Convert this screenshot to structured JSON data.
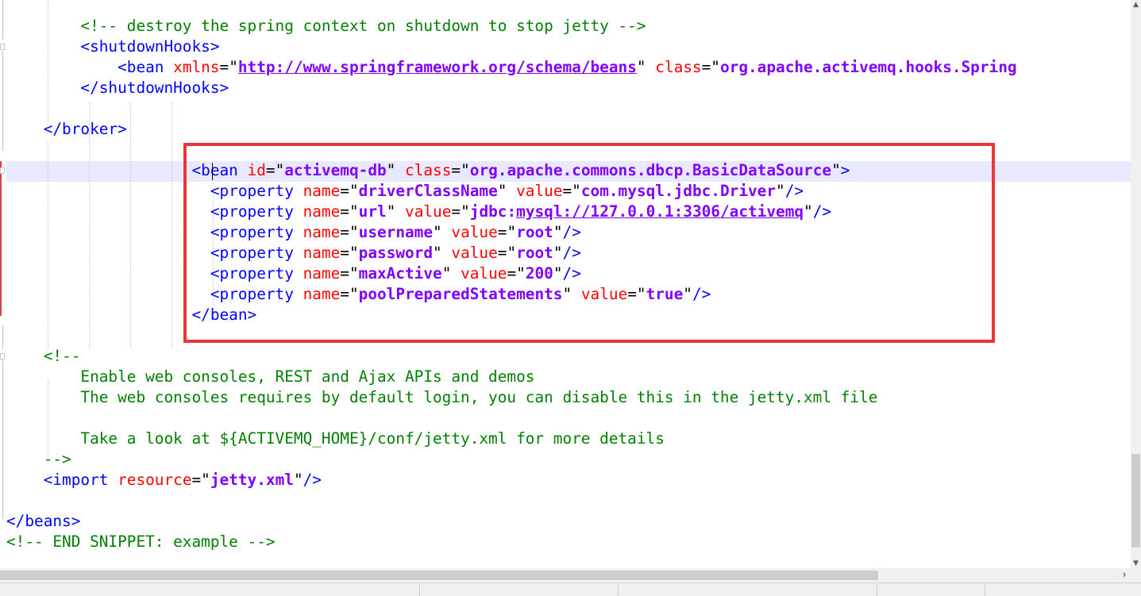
{
  "editor": {
    "lines": [
      [
        {
          "c": "cmt",
          "t": "        <!-- destroy the spring context on shutdown to stop jetty -->"
        }
      ],
      [
        {
          "c": "tag",
          "t": "        <shutdownHooks>"
        }
      ],
      [
        {
          "c": "tag",
          "t": "            <bean "
        },
        {
          "c": "attr",
          "t": "xmlns"
        },
        {
          "c": "txt",
          "t": "=\""
        },
        {
          "c": "val u",
          "t": "http://www.springframework.org/schema/beans"
        },
        {
          "c": "txt",
          "t": "\" "
        },
        {
          "c": "attr",
          "t": "class"
        },
        {
          "c": "txt",
          "t": "=\""
        },
        {
          "c": "val",
          "t": "org.apache.activemq.hooks.Spring"
        }
      ],
      [
        {
          "c": "tag",
          "t": "        </shutdownHooks>"
        }
      ],
      [],
      [
        {
          "c": "tag",
          "t": "    </broker>"
        }
      ],
      [],
      [
        {
          "c": "tag",
          "t": "                    <bean "
        },
        {
          "c": "attr",
          "t": "id"
        },
        {
          "c": "txt",
          "t": "=\""
        },
        {
          "c": "val",
          "t": "activemq-db"
        },
        {
          "c": "txt",
          "t": "\" "
        },
        {
          "c": "attr",
          "t": "class"
        },
        {
          "c": "txt",
          "t": "=\""
        },
        {
          "c": "val",
          "t": "org.apache.commons.dbcp.BasicDataSource"
        },
        {
          "c": "txt",
          "t": "\""
        },
        {
          "c": "tag",
          "t": ">"
        }
      ],
      [
        {
          "c": "tag",
          "t": "                      <property "
        },
        {
          "c": "attr",
          "t": "name"
        },
        {
          "c": "txt",
          "t": "=\""
        },
        {
          "c": "val",
          "t": "driverClassName"
        },
        {
          "c": "txt",
          "t": "\" "
        },
        {
          "c": "attr",
          "t": "value"
        },
        {
          "c": "txt",
          "t": "=\""
        },
        {
          "c": "val",
          "t": "com.mysql.jdbc.Driver"
        },
        {
          "c": "txt",
          "t": "\""
        },
        {
          "c": "tag",
          "t": "/>"
        }
      ],
      [
        {
          "c": "tag",
          "t": "                      <property "
        },
        {
          "c": "attr",
          "t": "name"
        },
        {
          "c": "txt",
          "t": "=\""
        },
        {
          "c": "val",
          "t": "url"
        },
        {
          "c": "txt",
          "t": "\" "
        },
        {
          "c": "attr",
          "t": "value"
        },
        {
          "c": "txt",
          "t": "=\""
        },
        {
          "c": "val",
          "t": "jdbc:"
        },
        {
          "c": "val u",
          "t": "mysql://127.0.0.1:3306/activemq"
        },
        {
          "c": "txt",
          "t": "\""
        },
        {
          "c": "tag",
          "t": "/>"
        }
      ],
      [
        {
          "c": "tag",
          "t": "                      <property "
        },
        {
          "c": "attr",
          "t": "name"
        },
        {
          "c": "txt",
          "t": "=\""
        },
        {
          "c": "val",
          "t": "username"
        },
        {
          "c": "txt",
          "t": "\" "
        },
        {
          "c": "attr",
          "t": "value"
        },
        {
          "c": "txt",
          "t": "=\""
        },
        {
          "c": "val",
          "t": "root"
        },
        {
          "c": "txt",
          "t": "\""
        },
        {
          "c": "tag",
          "t": "/>"
        }
      ],
      [
        {
          "c": "tag",
          "t": "                      <property "
        },
        {
          "c": "attr",
          "t": "name"
        },
        {
          "c": "txt",
          "t": "=\""
        },
        {
          "c": "val",
          "t": "password"
        },
        {
          "c": "txt",
          "t": "\" "
        },
        {
          "c": "attr",
          "t": "value"
        },
        {
          "c": "txt",
          "t": "=\""
        },
        {
          "c": "val",
          "t": "root"
        },
        {
          "c": "txt",
          "t": "\""
        },
        {
          "c": "tag",
          "t": "/>"
        }
      ],
      [
        {
          "c": "tag",
          "t": "                      <property "
        },
        {
          "c": "attr",
          "t": "name"
        },
        {
          "c": "txt",
          "t": "=\""
        },
        {
          "c": "val",
          "t": "maxActive"
        },
        {
          "c": "txt",
          "t": "\" "
        },
        {
          "c": "attr",
          "t": "value"
        },
        {
          "c": "txt",
          "t": "=\""
        },
        {
          "c": "val",
          "t": "200"
        },
        {
          "c": "txt",
          "t": "\""
        },
        {
          "c": "tag",
          "t": "/>"
        }
      ],
      [
        {
          "c": "tag",
          "t": "                      <property "
        },
        {
          "c": "attr",
          "t": "name"
        },
        {
          "c": "txt",
          "t": "=\""
        },
        {
          "c": "val",
          "t": "poolPreparedStatements"
        },
        {
          "c": "txt",
          "t": "\" "
        },
        {
          "c": "attr",
          "t": "value"
        },
        {
          "c": "txt",
          "t": "=\""
        },
        {
          "c": "val",
          "t": "true"
        },
        {
          "c": "txt",
          "t": "\""
        },
        {
          "c": "tag",
          "t": "/>"
        }
      ],
      [
        {
          "c": "tag",
          "t": "                    </bean>"
        }
      ],
      [],
      [
        {
          "c": "cmt",
          "t": "    <!--"
        }
      ],
      [
        {
          "c": "cmt",
          "t": "        Enable web consoles, REST and Ajax APIs and demos"
        }
      ],
      [
        {
          "c": "cmt",
          "t": "        The web consoles requires by default login, you can disable this in the jetty.xml file"
        }
      ],
      [],
      [
        {
          "c": "cmt",
          "t": "        Take a look at ${ACTIVEMQ_HOME}/conf/jetty.xml for more details"
        }
      ],
      [
        {
          "c": "cmt",
          "t": "    -->"
        }
      ],
      [
        {
          "c": "tag",
          "t": "    <import "
        },
        {
          "c": "attr",
          "t": "resource"
        },
        {
          "c": "txt",
          "t": "=\""
        },
        {
          "c": "val",
          "t": "jetty.xml"
        },
        {
          "c": "txt",
          "t": "\""
        },
        {
          "c": "tag",
          "t": "/>"
        }
      ],
      [],
      [
        {
          "c": "tag",
          "t": "</beans>"
        }
      ],
      [
        {
          "c": "cmt",
          "t": "<!-- END SNIPPET: example -->"
        }
      ]
    ]
  },
  "colors": {
    "tag": "#0000ff",
    "attribute": "#ff0000",
    "value": "#8000ff",
    "comment": "#008000",
    "highlight_box": "#e8363c",
    "current_line": "#e8e8ff"
  }
}
